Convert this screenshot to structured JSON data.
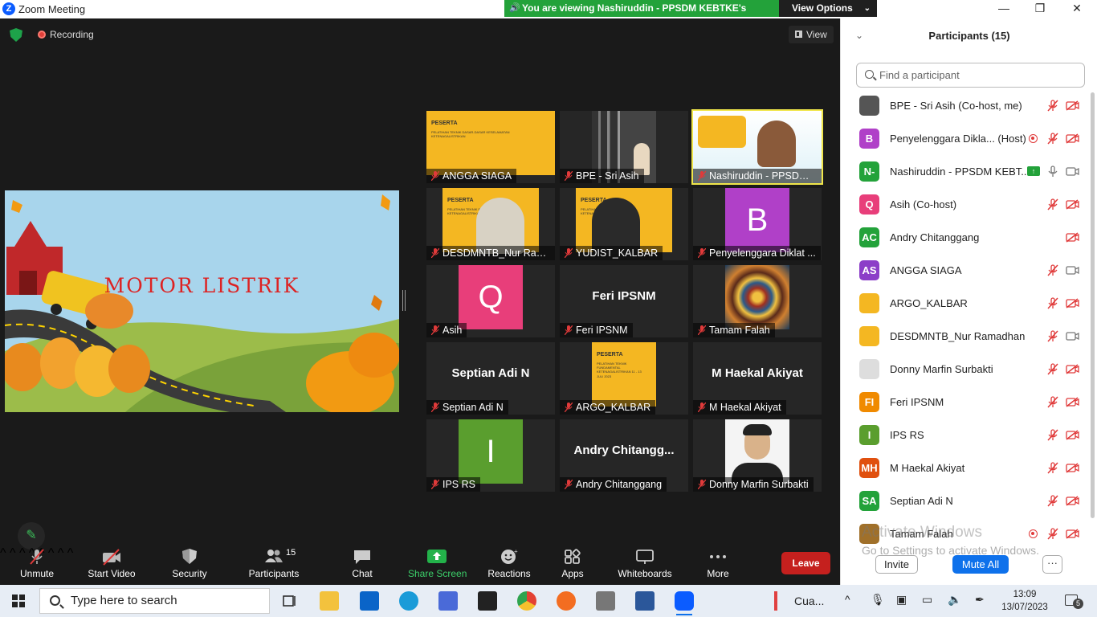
{
  "window": {
    "title": "Zoom Meeting",
    "logo": "Z"
  },
  "banner": {
    "text": "You are viewing Nashiruddin - PPSDM KEBTKE's screen",
    "view_options": "View Options"
  },
  "stage": {
    "recording_label": "Recording",
    "view_label": "View"
  },
  "shared_screen": {
    "slide_title": "MOTOR LISTRIK"
  },
  "tiles": [
    {
      "name": "ANGGA SIAGA",
      "kind": "poster",
      "poster_title": "PESERTA",
      "poster_sub": "PELATIHAN TEKNIK DASAR-DASAR KESELAMATAN KETENAGALISTRIKAN"
    },
    {
      "name": "BPE - Sri Asih",
      "kind": "video"
    },
    {
      "name": "Nashiruddin - PPSDM K...",
      "kind": "video",
      "active": true
    },
    {
      "name": "DESDMNTB_Nur Ram...",
      "kind": "poster",
      "poster_title": "PESERTA",
      "poster_sub": "PELATIHAN TEKNIK FUNDAMENTAL KETENAGALISTRIKAN"
    },
    {
      "name": "YUDIST_KALBAR",
      "kind": "poster",
      "poster_title": "PESERTA",
      "poster_sub": "PELATIHAN TEKNIK FUNDAMENTAL KETENAGALISTRIKAN"
    },
    {
      "name": "Penyelenggara Diklat ...",
      "kind": "avatar",
      "initial": "B",
      "color": "#b040c8"
    },
    {
      "name": "Asih",
      "kind": "avatar",
      "initial": "Q",
      "color": "#e83e7a"
    },
    {
      "name": "Feri IPSNM",
      "kind": "text",
      "big": "Feri IPSNM"
    },
    {
      "name": "Tamam Falah",
      "kind": "pattern"
    },
    {
      "name": "Septian Adi N",
      "kind": "text",
      "big": "Septian Adi N"
    },
    {
      "name": "ARGO_KALBAR",
      "kind": "poster",
      "poster_title": "PESERTA",
      "poster_sub": "PELATIHAN TEKNIK FUNDAMENTAL KETENAGALISTRIKAN 11 - 13 JULI 2023"
    },
    {
      "name": "M Haekal Akiyat",
      "kind": "text",
      "big": "M Haekal Akiyat"
    },
    {
      "name": "IPS RS",
      "kind": "avatar",
      "initial": "I",
      "color": "#5a9e2e"
    },
    {
      "name": "Andry Chitanggang",
      "kind": "text",
      "big": "Andry  Chitangg..."
    },
    {
      "name": "Donny Marfin Surbakti",
      "kind": "photo"
    }
  ],
  "toolbar": {
    "unmute": "Unmute",
    "start_video": "Start Video",
    "security": "Security",
    "participants": "Participants",
    "participants_count": "15",
    "chat": "Chat",
    "share_screen": "Share Screen",
    "reactions": "Reactions",
    "apps": "Apps",
    "whiteboards": "Whiteboards",
    "more": "More",
    "leave": "Leave"
  },
  "panel": {
    "title": "Participants (15)",
    "search_placeholder": "Find a participant",
    "participants": [
      {
        "name": "BPE - Sri Asih (Co-host, me)",
        "initials": "",
        "color": "#555",
        "mic": "muted",
        "cam": "off"
      },
      {
        "name": "Penyelenggara Dikla... (Host)",
        "initials": "B",
        "color": "#b040c8",
        "mic": "muted",
        "cam": "off",
        "recording": true
      },
      {
        "name": "Nashiruddin - PPSDM KEBT...",
        "initials": "N-",
        "color": "#23a23a",
        "mic": "on",
        "cam": "on",
        "sharing": true
      },
      {
        "name": "Asih (Co-host)",
        "initials": "Q",
        "color": "#e83e7a",
        "mic": "muted",
        "cam": "off"
      },
      {
        "name": "Andry Chitanggang",
        "initials": "AC",
        "color": "#23a23a",
        "mic": "none",
        "cam": "off"
      },
      {
        "name": "ANGGA SIAGA",
        "initials": "AS",
        "color": "#8c3ec8",
        "mic": "muted",
        "cam": "on"
      },
      {
        "name": "ARGO_KALBAR",
        "initials": "",
        "color": "#f4b722",
        "mic": "muted",
        "cam": "off"
      },
      {
        "name": "DESDMNTB_Nur Ramadhan",
        "initials": "",
        "color": "#f4b722",
        "mic": "muted",
        "cam": "on"
      },
      {
        "name": "Donny Marfin Surbakti",
        "initials": "",
        "color": "#ddd",
        "mic": "muted",
        "cam": "off"
      },
      {
        "name": "Feri IPSNM",
        "initials": "FI",
        "color": "#f08a00",
        "mic": "muted",
        "cam": "off"
      },
      {
        "name": "IPS RS",
        "initials": "I",
        "color": "#5a9e2e",
        "mic": "muted",
        "cam": "off"
      },
      {
        "name": "M Haekal Akiyat",
        "initials": "MH",
        "color": "#e0500f",
        "mic": "muted",
        "cam": "off"
      },
      {
        "name": "Septian Adi N",
        "initials": "SA",
        "color": "#23a23a",
        "mic": "muted",
        "cam": "off"
      },
      {
        "name": "Tamam Falah",
        "initials": "",
        "color": "#a0702a",
        "mic": "muted",
        "cam": "off",
        "recording": true
      }
    ],
    "watermark_line1": "Activate Windows",
    "watermark_line2": "Go to Settings to activate Windows.",
    "invite": "Invite",
    "mute_all": "Mute All",
    "more": "···"
  },
  "taskbar": {
    "search_placeholder": "Type here to search",
    "weather": "Cua...",
    "time": "13:09",
    "date": "13/07/2023",
    "notifications": "5"
  }
}
